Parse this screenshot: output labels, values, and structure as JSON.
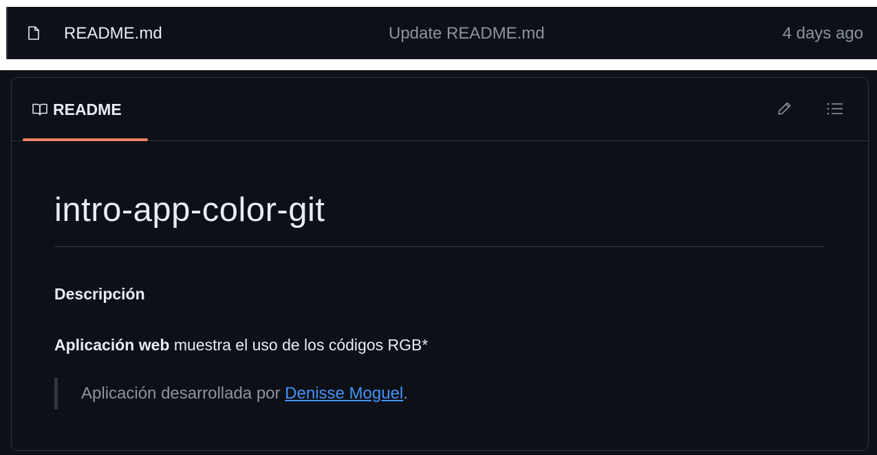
{
  "file_row": {
    "icon": "file-icon",
    "name": "README.md",
    "commit_message": "Update README.md",
    "time": "4 days ago"
  },
  "readme": {
    "tab": {
      "icon": "book-icon",
      "label": "README"
    },
    "actions": [
      {
        "name": "edit",
        "icon": "pencil-icon"
      },
      {
        "name": "outline",
        "icon": "list-icon"
      }
    ],
    "accent_color": "#f78166",
    "content": {
      "title": "intro-app-color-git",
      "section_heading": "Descripción",
      "paragraph_bold": "Aplicación web",
      "paragraph_rest": " muestra el uso de los códigos RGB*",
      "quote_prefix": "Aplicación desarrollada por ",
      "quote_link": "Denisse Moguel",
      "quote_suffix": "."
    }
  },
  "colors": {
    "background": "#0d1117",
    "border": "#30363d",
    "text": "#e6edf3",
    "muted": "#8b949e",
    "link": "#4493f8"
  }
}
